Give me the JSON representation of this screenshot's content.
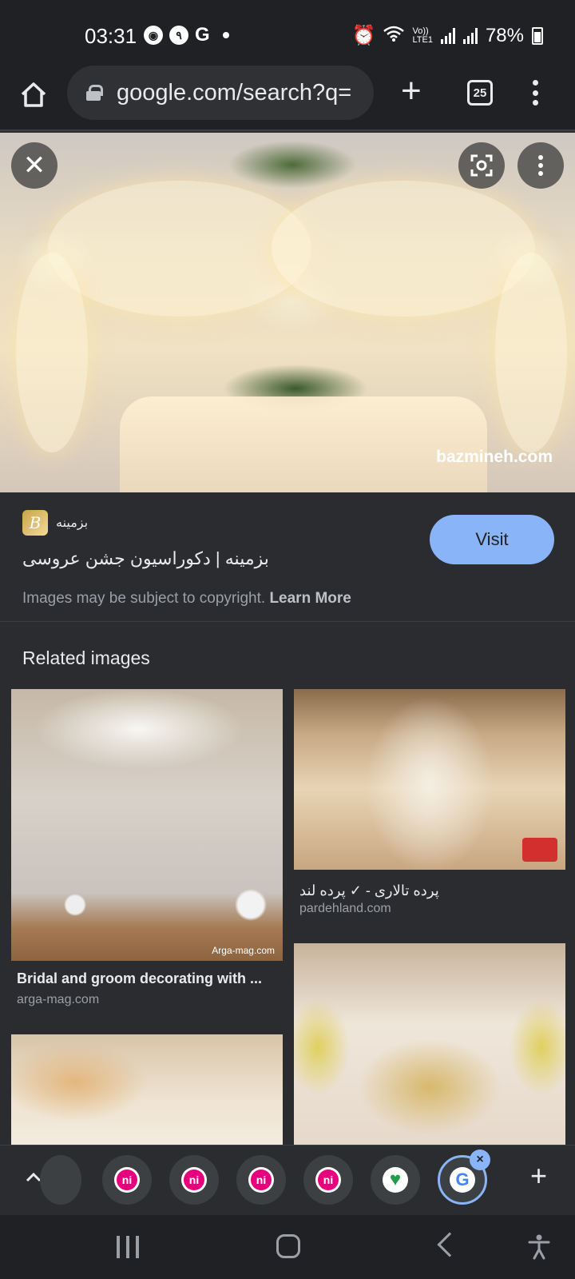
{
  "status_bar": {
    "time": "03:31",
    "notif_icon_2": "٩",
    "notif_g": "G",
    "volte": "Vo))",
    "lte": "LTE1",
    "battery": "78%"
  },
  "browser": {
    "url": "google.com/search?q=",
    "tab_count": "25"
  },
  "hero": {
    "watermark": "bazmineh.com"
  },
  "source": {
    "site_name": "بزمینه",
    "favicon_letter": "B",
    "page_title": "بزمینه | دکوراسیون جشن عروسی",
    "visit_label": "Visit",
    "copyright_text": "Images may be subject to copyright.",
    "learn_more": "Learn More"
  },
  "related": {
    "heading": "Related images",
    "items": [
      {
        "title": "Bridal and groom decorating with ...",
        "site": "arga-mag.com",
        "watermark": "Arga-mag.com"
      },
      {
        "title": "پرده تالاری - ✓ پرده لند",
        "site": "pardehland.com"
      },
      {
        "title": "",
        "site": ""
      },
      {
        "title": "",
        "site": ""
      }
    ]
  },
  "tab_strip": {
    "tabs": [
      "ni",
      "ni",
      "ni",
      "ni"
    ],
    "close_label": "×",
    "new_tab": "+"
  },
  "colors": {
    "background": "#2b2c30",
    "toolbar": "#202124",
    "accent": "#8ab4f8",
    "ni_brand": "#e6007e"
  },
  "icons": [
    "home-icon",
    "lock-icon",
    "plus-icon",
    "tabs-icon",
    "more-vert-icon",
    "close-icon",
    "lens-icon",
    "chevron-up-icon",
    "recents-icon",
    "home-nav-icon",
    "back-icon",
    "accessibility-icon"
  ]
}
